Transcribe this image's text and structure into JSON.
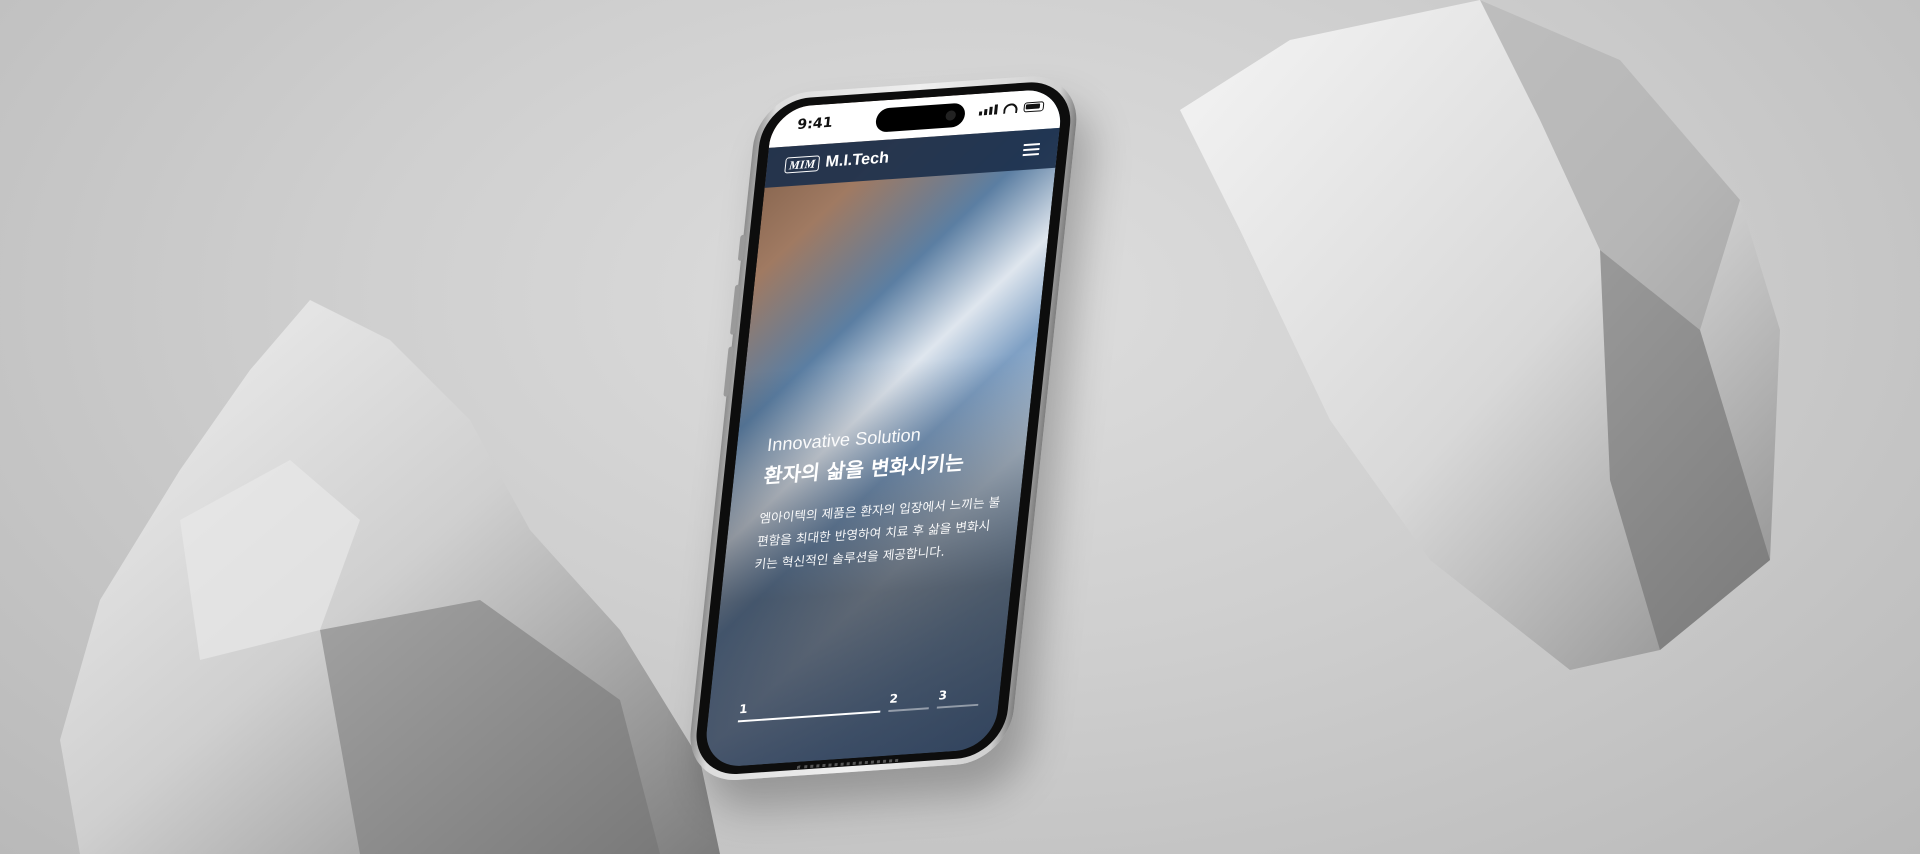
{
  "status_bar": {
    "time": "9:41"
  },
  "app_bar": {
    "logo_mark": "MIM",
    "brand_name": "M.I.Tech",
    "menu_icon": "hamburger-menu-icon"
  },
  "hero": {
    "eyebrow": "Innovative Solution",
    "headline": "환자의 삶을 변화시키는",
    "description": "엠아이텍의 제품은 환자의 입장에서 느끼는 불편함을 최대한 반영하여 치료 후 삶을 변화시키는 혁신적인 솔루션을 제공합니다."
  },
  "pager": {
    "items": [
      {
        "label": "1",
        "active": true
      },
      {
        "label": "2",
        "active": false
      },
      {
        "label": "3",
        "active": false
      }
    ]
  },
  "colors": {
    "app_bar_bg": "#1c304c",
    "background": "#cfcfcf",
    "text_light": "#ffffff"
  }
}
